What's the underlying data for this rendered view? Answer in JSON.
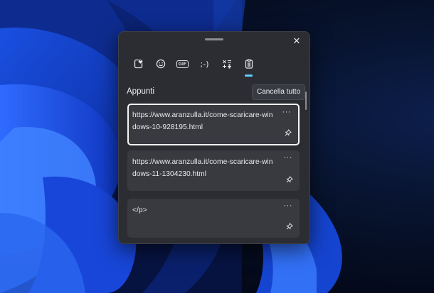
{
  "panel": {
    "close_glyph": "✕",
    "tabs": [
      {
        "name": "emoji-recent-tab",
        "icon": "heart-note-icon"
      },
      {
        "name": "emoji-tab",
        "icon": "smiley-icon"
      },
      {
        "name": "gif-tab",
        "icon": "gif-icon",
        "label": "GIF"
      },
      {
        "name": "kaomoji-tab",
        "icon": "kaomoji-icon",
        "label": ";-)"
      },
      {
        "name": "symbols-tab",
        "icon": "symbols-icon"
      },
      {
        "name": "clipboard-tab",
        "icon": "clipboard-icon",
        "active": true
      }
    ],
    "section_title": "Appunti",
    "clear_label": "Cancella tutto",
    "more_glyph": "···",
    "items": [
      {
        "text": "https://www.aranzulla.it/come-scaricare-windows-10-928195.html",
        "selected": true
      },
      {
        "text": "https://www.aranzulla.it/come-scaricare-windows-11-1304230.html",
        "selected": false
      },
      {
        "text": "</p>",
        "selected": false
      }
    ]
  },
  "colors": {
    "accent": "#60cdff",
    "panel_bg": "#2b2d33",
    "item_bg": "#383a40"
  }
}
